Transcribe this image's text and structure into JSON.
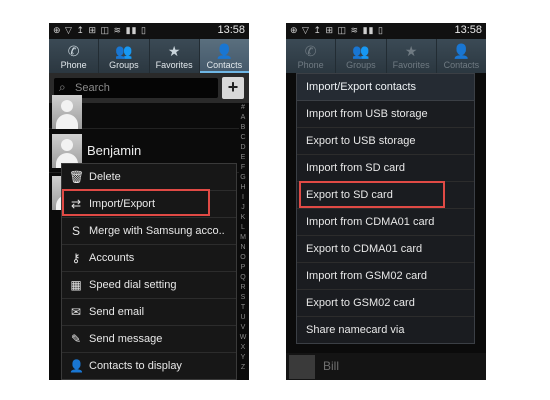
{
  "status": {
    "time": "13:58",
    "icons": "⊕ ▽ ↥ ⊞  ◫ ≋ ▮▮ ▯"
  },
  "tabs": [
    {
      "label": "Phone",
      "icon": "phone-icon",
      "glyph": "✆"
    },
    {
      "label": "Groups",
      "icon": "groups-icon",
      "glyph": "👥"
    },
    {
      "label": "Favorites",
      "icon": "star-icon",
      "glyph": "★"
    },
    {
      "label": "Contacts",
      "icon": "person-icon",
      "glyph": "👤"
    }
  ],
  "search": {
    "placeholder": "Search",
    "add_label": "+"
  },
  "contacts_left": [
    {
      "name": ""
    },
    {
      "name": "Benjamin"
    },
    {
      "name": ""
    }
  ],
  "index_letters": [
    "#",
    "A",
    "B",
    "C",
    "D",
    "E",
    "F",
    "G",
    "H",
    "I",
    "J",
    "K",
    "L",
    "M",
    "N",
    "O",
    "P",
    "Q",
    "R",
    "S",
    "T",
    "U",
    "V",
    "W",
    "X",
    "Y",
    "Z"
  ],
  "left_menu": {
    "items": [
      {
        "label": "Delete",
        "icon": "trash-icon",
        "glyph": "🗑"
      },
      {
        "label": "Import/Export",
        "icon": "import-export-icon",
        "glyph": "⇄"
      },
      {
        "label": "Merge with Samsung acco..",
        "icon": "samsung-icon",
        "glyph": "S"
      },
      {
        "label": "Accounts",
        "icon": "key-icon",
        "glyph": "⚷"
      },
      {
        "label": "Speed dial setting",
        "icon": "dialpad-icon",
        "glyph": "▦"
      },
      {
        "label": "Send email",
        "icon": "email-icon",
        "glyph": "✉"
      },
      {
        "label": "Send message",
        "icon": "message-icon",
        "glyph": "✎"
      },
      {
        "label": "Contacts to display",
        "icon": "contacts-display-icon",
        "glyph": "👤"
      }
    ],
    "highlighted": "Import/Export"
  },
  "right_menu": {
    "title": "Import/Export contacts",
    "items": [
      {
        "label": "Import from USB storage"
      },
      {
        "label": "Export to USB storage"
      },
      {
        "label": "Import from SD card"
      },
      {
        "label": "Export to SD card"
      },
      {
        "label": "Import from CDMA01 card"
      },
      {
        "label": "Export to CDMA01 card"
      },
      {
        "label": "Import from GSM02 card"
      },
      {
        "label": "Export to GSM02 card"
      },
      {
        "label": "Share namecard via"
      }
    ],
    "highlighted": "Export to SD card"
  },
  "bottom_contact": {
    "name": "Bill"
  },
  "colors": {
    "highlight": "#e04a45",
    "tab_accent": "#6fb7e6",
    "tabbar": "#3b4a55"
  }
}
